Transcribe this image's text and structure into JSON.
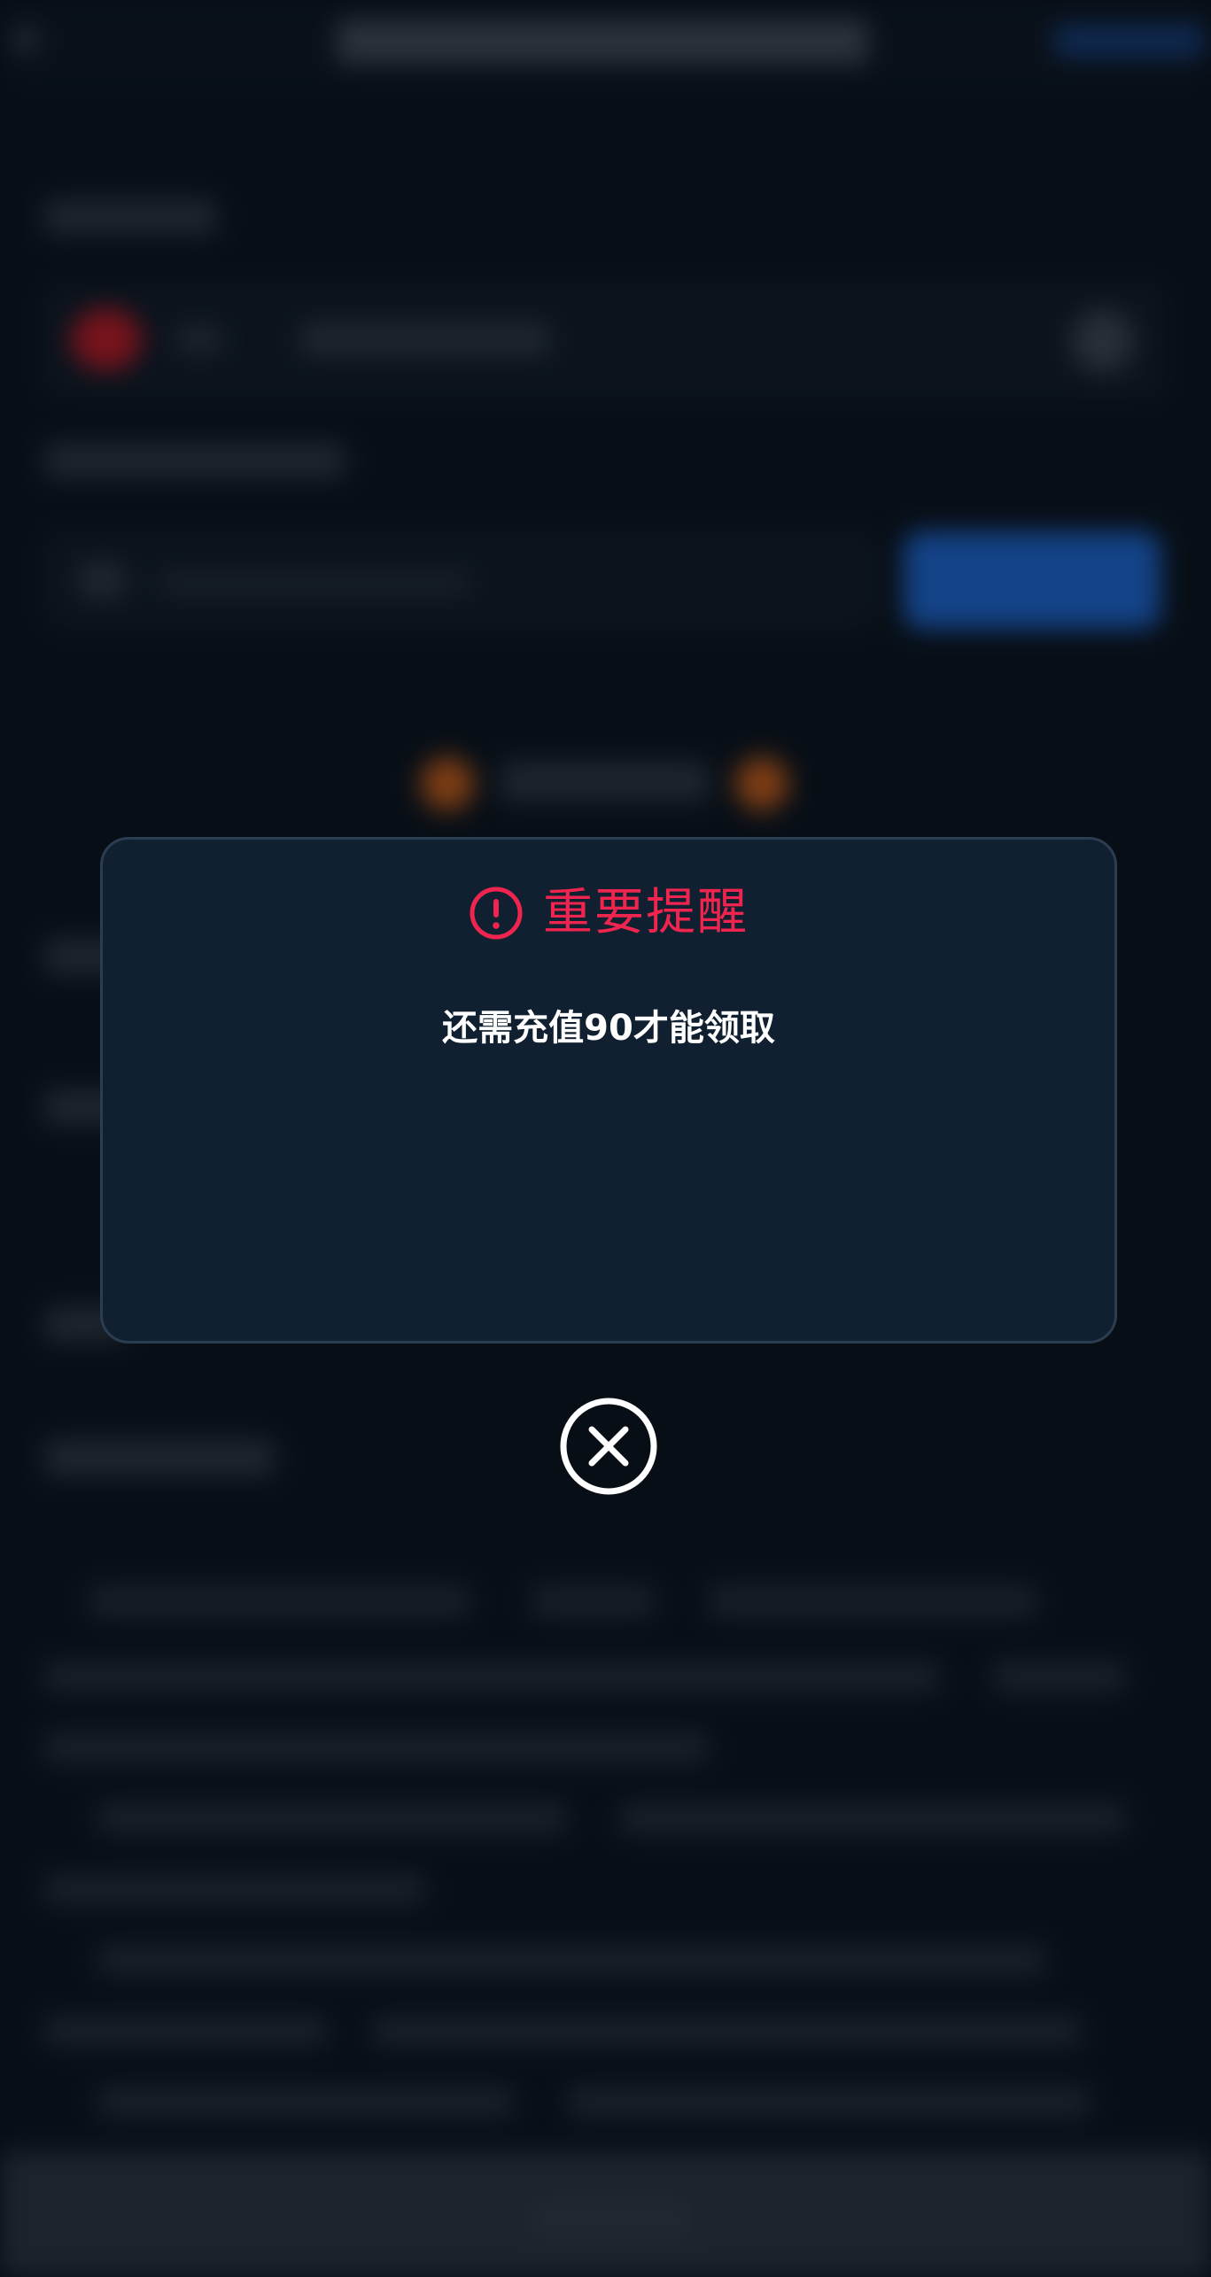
{
  "dialog": {
    "title": "重要提醒",
    "message": "还需充值90才能领取",
    "title_color": "#f0254f",
    "icon": "alert-circle-icon",
    "close_icon": "close-circle-icon"
  },
  "colors": {
    "modal_background": "#112030",
    "modal_border": "#2b3d50",
    "page_background": "#0a1018",
    "accent_blue": "#1d62c8",
    "accent_red": "#b51a23"
  }
}
